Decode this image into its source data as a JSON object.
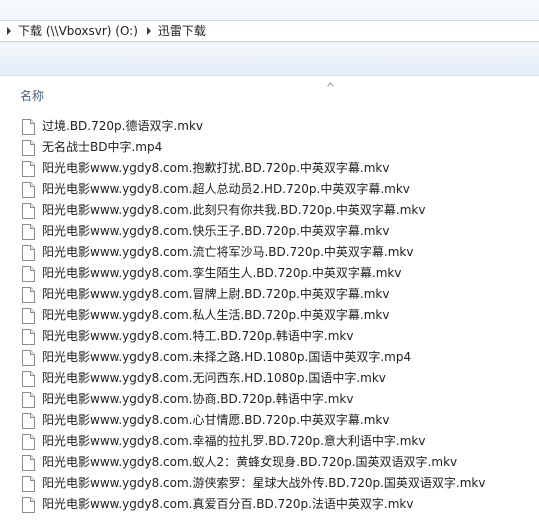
{
  "address_bar": {
    "breadcrumbs": [
      {
        "label": "下载 (\\\\Vboxsvr) (O:)"
      },
      {
        "label": "迅雷下载"
      }
    ]
  },
  "column_header": {
    "name_label": "名称"
  },
  "files": [
    {
      "name": "过境.BD.720p.德语双字.mkv"
    },
    {
      "name": "无名战士BD中字.mp4"
    },
    {
      "name": "阳光电影www.ygdy8.com.抱歉打扰.BD.720p.中英双字幕.mkv"
    },
    {
      "name": "阳光电影www.ygdy8.com.超人总动员2.HD.720p.中英双字幕.mkv"
    },
    {
      "name": "阳光电影www.ygdy8.com.此刻只有你共我.BD.720p.中英双字幕.mkv"
    },
    {
      "name": "阳光电影www.ygdy8.com.快乐王子.BD.720p.中英双字幕.mkv"
    },
    {
      "name": "阳光电影www.ygdy8.com.流亡将军沙马.BD.720p.中英双字幕.mkv"
    },
    {
      "name": "阳光电影www.ygdy8.com.孪生陌生人.BD.720p.中英双字幕.mkv"
    },
    {
      "name": "阳光电影www.ygdy8.com.冒牌上尉.BD.720p.中英双字幕.mkv"
    },
    {
      "name": "阳光电影www.ygdy8.com.私人生活.BD.720p.中英双字幕.mkv"
    },
    {
      "name": "阳光电影www.ygdy8.com.特工.BD.720p.韩语中字.mkv"
    },
    {
      "name": "阳光电影www.ygdy8.com.未择之路.HD.1080p.国语中英双字.mp4"
    },
    {
      "name": "阳光电影www.ygdy8.com.无问西东.HD.1080p.国语中字.mkv"
    },
    {
      "name": "阳光电影www.ygdy8.com.协商.BD.720p.韩语中字.mkv"
    },
    {
      "name": "阳光电影www.ygdy8.com.心甘情愿.BD.720p.中英双字幕.mkv"
    },
    {
      "name": "阳光电影www.ygdy8.com.幸福的拉扎罗.BD.720p.意大利语中字.mkv"
    },
    {
      "name": "阳光电影www.ygdy8.com.蚁人2：黄蜂女现身.BD.720p.国英双语双字.mkv"
    },
    {
      "name": "阳光电影www.ygdy8.com.游侠索罗：星球大战外传.BD.720p.国英双语双字.mkv"
    },
    {
      "name": "阳光电影www.ygdy8.com.真爱百分百.BD.720p.法语中英双字.mkv"
    }
  ],
  "colors": {
    "text": "#1e1e1e",
    "header_text": "#4c607a",
    "toolbar_top": "#f3f7fc",
    "toolbar_bottom": "#e4ecf7"
  }
}
